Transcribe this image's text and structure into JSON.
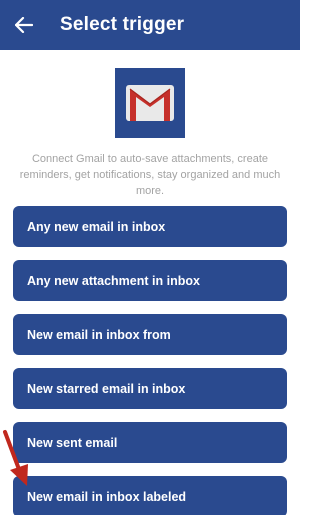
{
  "header": {
    "title": "Select trigger"
  },
  "service": {
    "logo_icon": "gmail-envelope-icon",
    "description": "Connect Gmail to auto-save attachments, create reminders, get notifications, stay organized and much more."
  },
  "triggers": [
    {
      "label": "Any new email in inbox"
    },
    {
      "label": "Any new attachment in inbox"
    },
    {
      "label": "New email in inbox from"
    },
    {
      "label": "New starred email in inbox"
    },
    {
      "label": "New sent email"
    },
    {
      "label": "New email in inbox labeled"
    }
  ],
  "colors": {
    "header": "#2a4a8f",
    "button": "#2a4a8f",
    "text_muted": "#a3a3a3",
    "annotation_arrow": "#c0281e"
  }
}
